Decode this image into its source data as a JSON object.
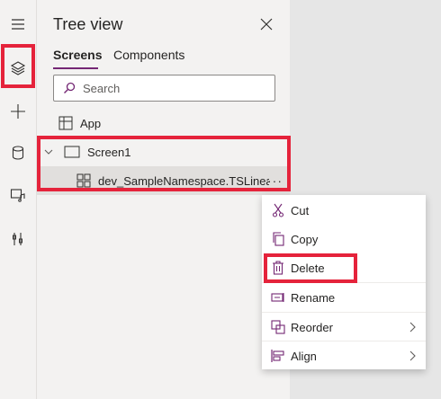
{
  "rail": {
    "items": [
      {
        "name": "hamburger-menu-icon"
      },
      {
        "name": "layers-icon"
      },
      {
        "name": "plus-icon"
      },
      {
        "name": "database-icon"
      },
      {
        "name": "media-icon"
      },
      {
        "name": "tools-icon"
      }
    ]
  },
  "panel": {
    "title": "Tree view",
    "tabs": [
      "Screens",
      "Components"
    ],
    "search_placeholder": "Search",
    "tree": {
      "app_label": "App",
      "screen_label": "Screen1",
      "child_label": "dev_SampleNamespace.TSLinearInp",
      "more": "···"
    }
  },
  "context_menu": {
    "items": [
      "Cut",
      "Copy",
      "Delete",
      "Rename",
      "Reorder",
      "Align"
    ]
  },
  "colors": {
    "accent": "#742774",
    "highlight": "#e5233b"
  }
}
